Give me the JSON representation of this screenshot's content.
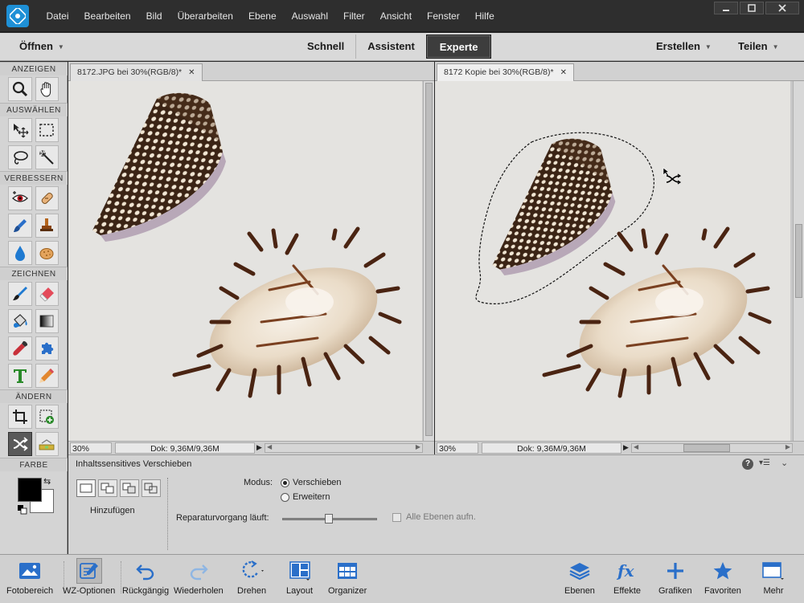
{
  "menubar": {
    "logo": "photoshop-elements-logo",
    "items": [
      "Datei",
      "Bearbeiten",
      "Bild",
      "Überarbeiten",
      "Ebene",
      "Auswahl",
      "Filter",
      "Ansicht",
      "Fenster",
      "Hilfe"
    ]
  },
  "modebar": {
    "open_label": "Öffnen",
    "tabs": [
      "Schnell",
      "Assistent",
      "Experte"
    ],
    "active_tab": "Experte",
    "create_label": "Erstellen",
    "share_label": "Teilen"
  },
  "tools": {
    "sections": [
      "ANZEIGEN",
      "AUSWÄHLEN",
      "VERBESSERN",
      "ZEICHNEN",
      "ÄNDERN",
      "FARBE"
    ],
    "active_tool": "content-aware-move-tool",
    "foreground_color": "#000000",
    "background_color": "#ffffff"
  },
  "doc1": {
    "tab_title": "8172.JPG bei 30%(RGB/8)*",
    "zoom": "30%",
    "doc_info": "Dok: 9,36M/9,36M"
  },
  "doc2": {
    "tab_title": "8172 Kopie bei 30%(RGB/8)*",
    "zoom": "30%",
    "doc_info": "Dok: 9,36M/9,36M"
  },
  "options": {
    "title": "Inhaltssensitives Verschieben",
    "add_label": "Hinzufügen",
    "modus_label": "Modus:",
    "modus_options": [
      "Verschieben",
      "Erweitern"
    ],
    "modus_selected": "Verschieben",
    "repair_label": "Reparaturvorgang läuft:",
    "all_layers_label": "Alle Ebenen aufn."
  },
  "bottombar": {
    "items": [
      "Fotobereich",
      "WZ-Optionen",
      "Rückgängig",
      "Wiederholen",
      "Drehen",
      "Layout",
      "Organizer",
      "Ebenen",
      "Effekte",
      "Grafiken",
      "Favoriten",
      "Mehr"
    ],
    "active": "WZ-Optionen"
  }
}
